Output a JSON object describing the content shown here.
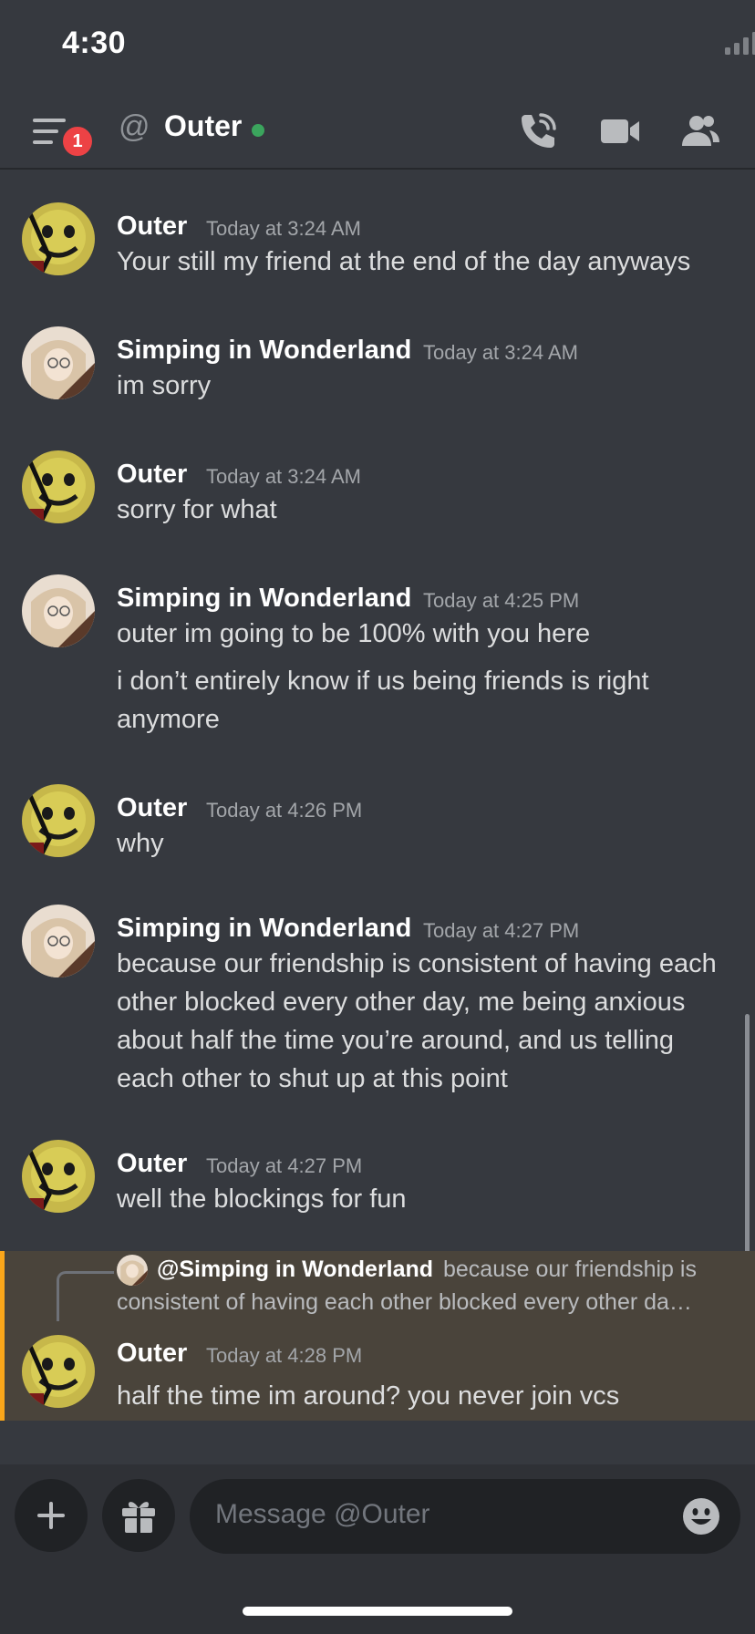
{
  "status_bar": {
    "time": "4:30"
  },
  "header": {
    "notification_count": "1",
    "at_symbol": "@",
    "channel_name": "Outer"
  },
  "messages": [
    {
      "author": "Outer",
      "timestamp": "Today at 3:24 AM",
      "lines": [
        "Your still my friend at the end of the day anyways"
      ]
    },
    {
      "author": "Simping in Wonderland",
      "timestamp": "Today at 3:24 AM",
      "lines": [
        "im sorry"
      ]
    },
    {
      "author": "Outer",
      "timestamp": "Today at 3:24 AM",
      "lines": [
        "sorry for what"
      ]
    },
    {
      "author": "Simping in Wonderland",
      "timestamp": "Today at 4:25 PM",
      "lines": [
        "outer im going to be 100% with you here",
        "i don’t entirely know if us being friends is right anymore"
      ]
    },
    {
      "author": "Outer",
      "timestamp": "Today at 4:26 PM",
      "lines": [
        "why"
      ]
    },
    {
      "author": "Simping in Wonderland",
      "timestamp": "Today at 4:27 PM",
      "lines": [
        "because our friendship is consistent of having each other blocked every other day, me being anxious about half the time you’re around, and us telling each other to shut up at this point"
      ]
    },
    {
      "author": "Outer",
      "timestamp": "Today at 4:27 PM",
      "lines": [
        "well the blockings for fun"
      ]
    },
    {
      "reply_to": {
        "author": "@Simping in Wonderland",
        "snippet_first": "because our friendship is",
        "snippet_second": "consistent of having each other blocked every other da…"
      },
      "author": "Outer",
      "timestamp": "Today at 4:28 PM",
      "lines": [
        "half the time im around? you never join vcs"
      ]
    }
  ],
  "composer": {
    "placeholder": "Message @Outer"
  },
  "colors": {
    "background": "#36393f",
    "highlight": "#4a443b",
    "highlight_bar": "#faa61a",
    "online": "#3ba55d",
    "badge": "#ed4245"
  }
}
